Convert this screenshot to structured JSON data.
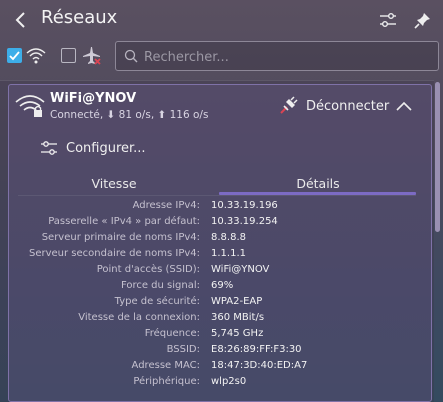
{
  "header": {
    "title": "Réseaux"
  },
  "toolbar": {
    "wifi_enabled": true,
    "airplane_mode": false,
    "search_placeholder": "Rechercher..."
  },
  "connection": {
    "name": "WiFi@YNOV",
    "status": "Connecté, ⬇ 81 o/s, ⬆ 116 o/s",
    "disconnect_label": "Déconnecter",
    "configure_label": "Configurer..."
  },
  "tabs": [
    {
      "label": "Vitesse",
      "active": false
    },
    {
      "label": "Détails",
      "active": true
    }
  ],
  "details": [
    {
      "key": "Adresse IPv4:",
      "value": "10.33.19.196"
    },
    {
      "key": "Passerelle « IPv4 » par défaut:",
      "value": "10.33.19.254"
    },
    {
      "key": "Serveur primaire de noms IPv4:",
      "value": "8.8.8.8"
    },
    {
      "key": "Serveur secondaire de noms IPv4:",
      "value": "1.1.1.1"
    },
    {
      "key": "Point d'accès (SSID):",
      "value": "WiFi@YNOV"
    },
    {
      "key": "Force du signal:",
      "value": "69%"
    },
    {
      "key": "Type de sécurité:",
      "value": "WPA2-EAP"
    },
    {
      "key": "Vitesse de la connexion:",
      "value": "360 MBit/s"
    },
    {
      "key": "Fréquence:",
      "value": "5,745 GHz"
    },
    {
      "key": "BSSID:",
      "value": "E8:26:89:FF:F3:30"
    },
    {
      "key": "Adresse MAC:",
      "value": "18:47:3D:40:ED:A7"
    },
    {
      "key": "Périphérique:",
      "value": "wlp2s0"
    }
  ],
  "colors": {
    "accent": "#3daee9",
    "tab_indicator": "#7c6bc4"
  }
}
